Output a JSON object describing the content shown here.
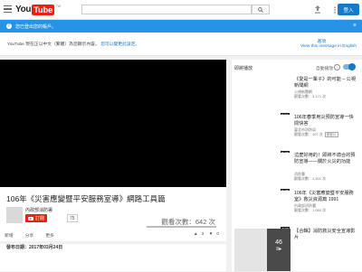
{
  "header": {
    "logo_you": "You",
    "logo_tube": "Tube",
    "logo_region": "TW",
    "signin_label": "登入",
    "search_placeholder": ""
  },
  "notice": {
    "icon": "!",
    "text": "您已登出您的帳戶。",
    "close": "×"
  },
  "language_bar": {
    "message": "YouTube 現在正以中文（繁體）為您顯示內容。",
    "link": "您可以變更此設定。",
    "options": "選項",
    "view_english": "View this message in English"
  },
  "video": {
    "title": "106年《災害應變暨平安服務室導》網路工具篇",
    "channel": "內政部消防署",
    "subscribe_label": "訂閱",
    "subscriber_count": "75",
    "views": "觀看次數：642 次",
    "actions": [
      "新增",
      "分享",
      "更多"
    ],
    "likes": "3",
    "dislikes": "0",
    "published": "發布日期：2017年03月24日"
  },
  "sidebar": {
    "up_next": "即將播放",
    "autoplay": "自動播放",
    "items": [
      {
        "title": "《愛是一輩子》的可能 – 公視新聞網",
        "channel": "公視新聞網",
        "views": "觀看次數：3,171 次",
        "duration": "5:56",
        "badge": ""
      },
      {
        "title": "106年春季用災預防宣導一快問快答",
        "channel": "臺北市消防局",
        "views": "觀看次數：107 次",
        "duration": "9:26",
        "badge": "新影片"
      },
      {
        "title": "這麼好用的！即將不適合的預防宣導——關於火災的功能",
        "channel": "消防署",
        "views": "觀看次數：1,201 次",
        "duration": "6:39",
        "badge": ""
      },
      {
        "title": "106年《災害應變暨平安服務室》救災資源篇 1991",
        "channel": "內政部消防署",
        "views": "觀看次數：1,080 次",
        "duration": "4:02",
        "badge": ""
      },
      {
        "title": "【合輯】消防救災安全宣導影片",
        "channel": "",
        "views": "",
        "duration": "",
        "badge": "",
        "playlist_count": "46"
      }
    ]
  }
}
